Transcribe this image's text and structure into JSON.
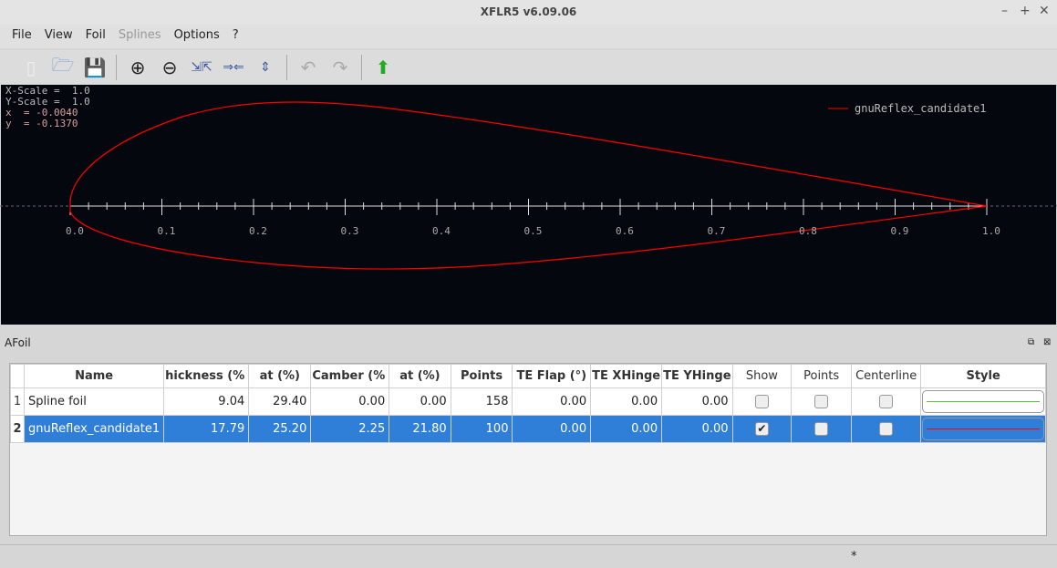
{
  "window": {
    "title": "XFLR5 v6.09.06"
  },
  "menu": [
    "File",
    "View",
    "Foil",
    "Splines",
    "Options",
    "?"
  ],
  "menu_disabled": [
    "Splines"
  ],
  "toolbar": [
    "new-file-icon",
    "open-folder-icon",
    "save-icon",
    "zoom-in-icon",
    "zoom-out-icon",
    "reset-scale-icon",
    "reset-x-scale-icon",
    "reset-y-scale-icon",
    "undo-icon",
    "redo-icon",
    "export-icon"
  ],
  "plot": {
    "x_scale": "X-Scale =  1.0",
    "y_scale": "Y-Scale =  1.0",
    "x": "x  = -0.0040",
    "y": "y  = -0.1370",
    "legend": "gnuReflex_candidate1",
    "legend_color": "#ff0000",
    "axis_labels": [
      "0.0",
      "0.1",
      "0.2",
      "0.3",
      "0.4",
      "0.5",
      "0.6",
      "0.7",
      "0.8",
      "0.9",
      "1.0"
    ]
  },
  "panel": {
    "title": "AFoil"
  },
  "table": {
    "headers": [
      "Name",
      "hickness (%",
      "at (%)",
      "Camber (%",
      "at (%)",
      "Points",
      "TE Flap (°)",
      "TE XHinge",
      "TE YHinge",
      "Show",
      "Points",
      "Centerline",
      "Style"
    ],
    "rows": [
      {
        "num": "1",
        "name": "Spline foil",
        "thickness": "9.04",
        "at1": "29.40",
        "camber": "0.00",
        "at2": "0.00",
        "points": "158",
        "flap": "0.00",
        "xhinge": "0.00",
        "yhinge": "0.00",
        "show": false,
        "pts": false,
        "centerline": false,
        "style_color": "#66bb44"
      },
      {
        "num": "2",
        "name": "gnuReflex_candidate1",
        "thickness": "17.79",
        "at1": "25.20",
        "camber": "2.25",
        "at2": "21.80",
        "points": "100",
        "flap": "0.00",
        "xhinge": "0.00",
        "yhinge": "0.00",
        "show": true,
        "pts": false,
        "centerline": false,
        "style_color": "#ff0000",
        "selected": true
      }
    ]
  },
  "status": {
    "text": "*"
  }
}
